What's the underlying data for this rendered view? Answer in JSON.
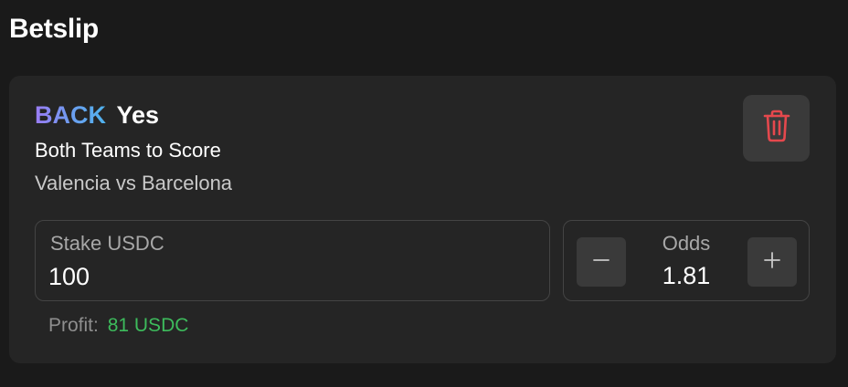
{
  "header": {
    "title": "Betslip"
  },
  "bet": {
    "side": "BACK",
    "selection": "Yes",
    "market": "Both Teams to Score",
    "event": "Valencia vs Barcelona"
  },
  "delete_button": {
    "icon": "trash-icon",
    "color": "#e5484d"
  },
  "stake": {
    "label": "Stake USDC",
    "value": "100"
  },
  "odds": {
    "label": "Odds",
    "value": "1.81",
    "decrement_icon": "minus-icon",
    "increment_icon": "plus-icon"
  },
  "profit": {
    "label": "Profit:",
    "value": "81 USDC",
    "color": "#3dbb5c"
  },
  "colors": {
    "background": "#1a1a1a",
    "card": "#252525",
    "button": "#3a3a3a",
    "back_gradient": [
      "#9b7cf5",
      "#4fb3ee"
    ]
  }
}
